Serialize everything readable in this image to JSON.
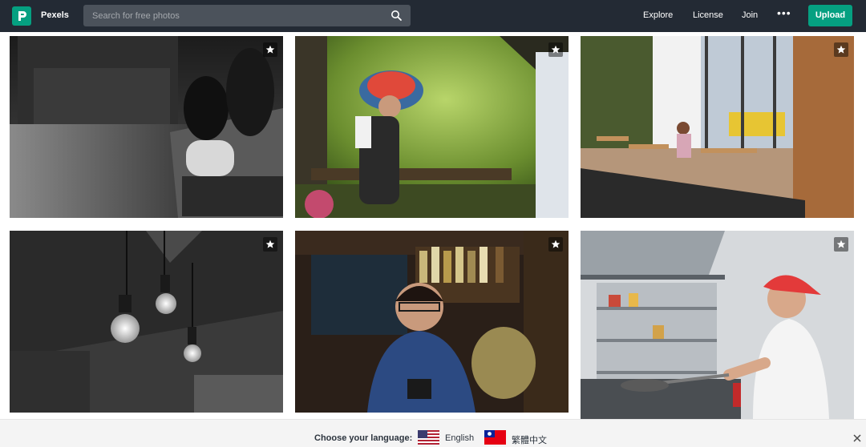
{
  "header": {
    "brand": "Pexels",
    "search_placeholder": "Search for free photos",
    "nav": [
      "Explore",
      "License",
      "Join"
    ],
    "more": "•••",
    "upload_label": "Upload"
  },
  "photos": [
    {
      "icon": "star-icon"
    },
    {
      "icon": "star-icon"
    },
    {
      "icon": "star-icon"
    },
    {
      "icon": "star-icon"
    },
    {
      "icon": "star-icon"
    },
    {
      "icon": "star-icon"
    }
  ],
  "language_bar": {
    "prompt": "Choose your language:",
    "options": [
      "English",
      "繁體中文"
    ],
    "close_icon": "close-icon"
  },
  "colors": {
    "header_bg": "#232a34",
    "accent": "#05a081",
    "search_bg": "#4b525b"
  }
}
